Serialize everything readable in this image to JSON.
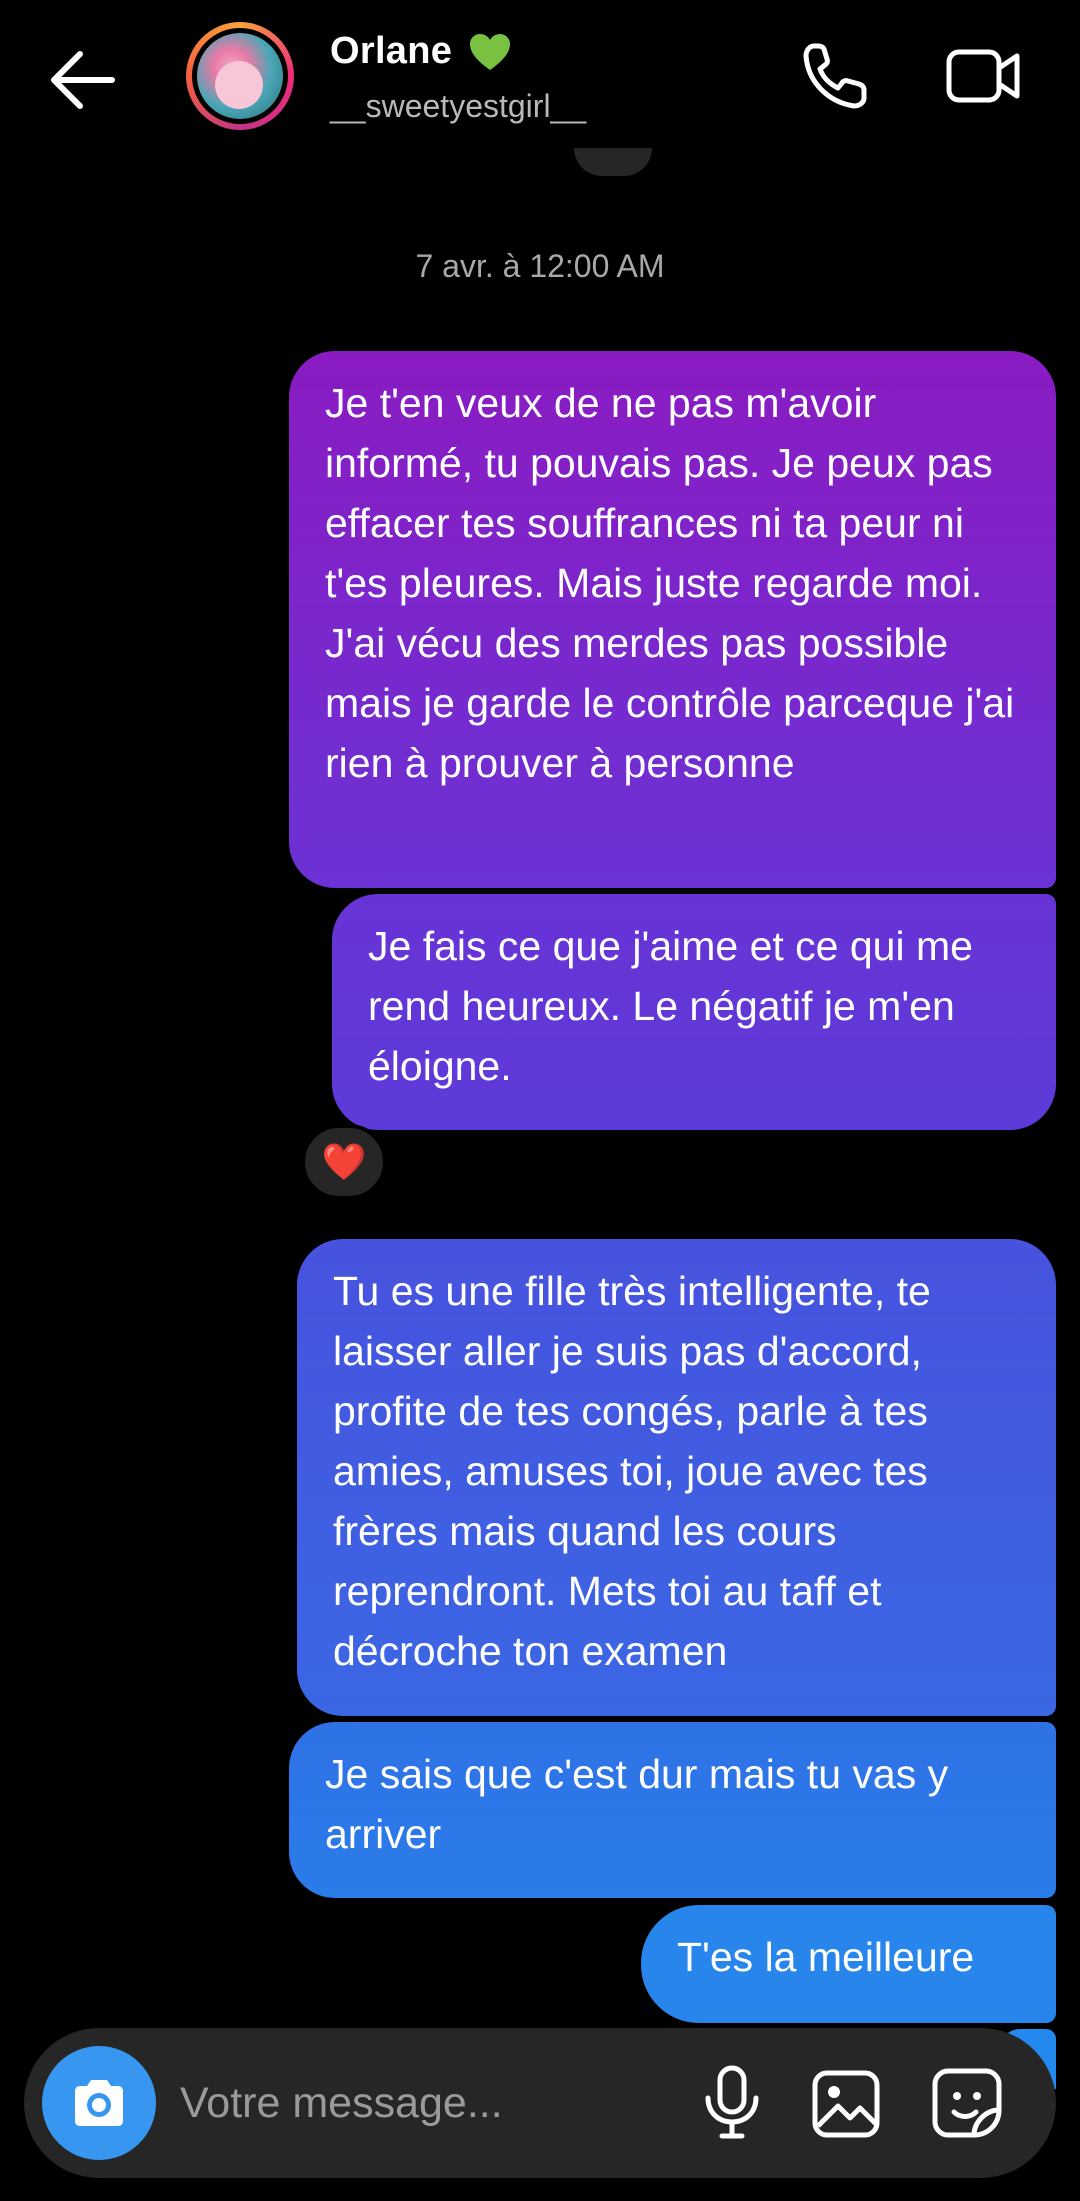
{
  "header": {
    "contact_name": "Orlane",
    "contact_username": "__sweetyestgirl__",
    "name_emoji_icon": "green-heart-icon"
  },
  "conversation": {
    "timestamp": "7 avr. à 12:00 AM",
    "messages": [
      {
        "text": "Je t'en veux de ne pas m'avoir informé, tu pouvais pas. Je peux pas effacer tes souffrances ni ta peur ni t'es pleures. Mais juste regarde moi. J'ai vécu des merdes pas possible mais je garde le contrôle parceque j'ai rien à prouver à personne"
      },
      {
        "text": "Je fais ce que j'aime et ce qui me rend heureux. Le négatif je m'en éloigne.",
        "reaction": "❤️"
      },
      {
        "text": "Tu es une fille très intelligente, te laisser aller je suis pas d'accord, profite de tes congés, parle à tes amies, amuses toi, joue avec tes frères mais quand les cours reprendront. Mets toi au taff et décroche ton examen"
      },
      {
        "text": "Je sais que c'est dur mais tu vas y arriver"
      },
      {
        "text": "T'es la meilleure"
      }
    ]
  },
  "composer": {
    "placeholder": "Votre message..."
  },
  "colors": {
    "background": "#000000",
    "composer_bg": "#262626",
    "camera_button": "#3797f0",
    "bubble_gradient_top": "#8a1bc2",
    "bubble_gradient_bottom": "#2785eb"
  }
}
